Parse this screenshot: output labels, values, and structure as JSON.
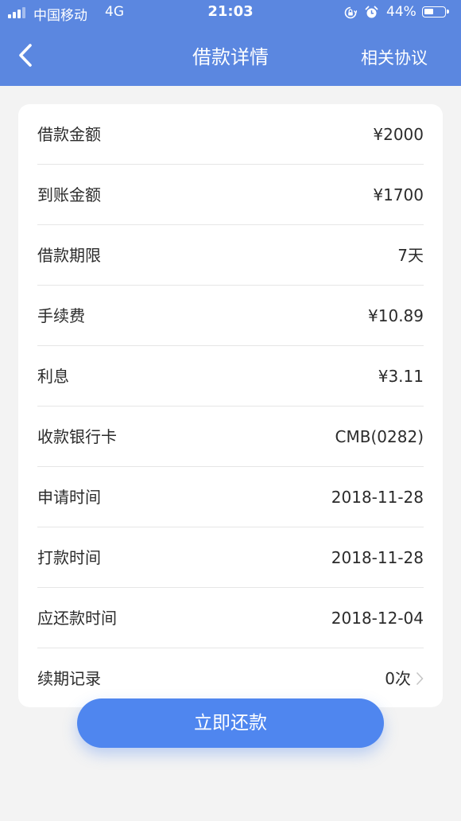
{
  "status_bar": {
    "carrier": "中国移动",
    "network": "4G",
    "time": "21:03",
    "battery": "44%",
    "battery_level": 0.44
  },
  "header": {
    "title": "借款详情",
    "agreement_link": "相关协议",
    "background": "#5b87e0"
  },
  "details": {
    "rows": [
      {
        "label": "借款金额",
        "value": "¥2000"
      },
      {
        "label": "到账金额",
        "value": "¥1700"
      },
      {
        "label": "借款期限",
        "value": "7天"
      },
      {
        "label": "手续费",
        "value": "¥10.89"
      },
      {
        "label": "利息",
        "value": "¥3.11"
      },
      {
        "label": "收款银行卡",
        "value": "CMB(0282)"
      },
      {
        "label": "申请时间",
        "value": "2018-11-28"
      },
      {
        "label": "打款时间",
        "value": "2018-11-28"
      },
      {
        "label": "应还款时间",
        "value": "2018-12-04"
      },
      {
        "label": "续期记录",
        "value": "0次"
      }
    ]
  },
  "actions": {
    "repay_label": "立即还款",
    "accent": "#4f86ef"
  }
}
